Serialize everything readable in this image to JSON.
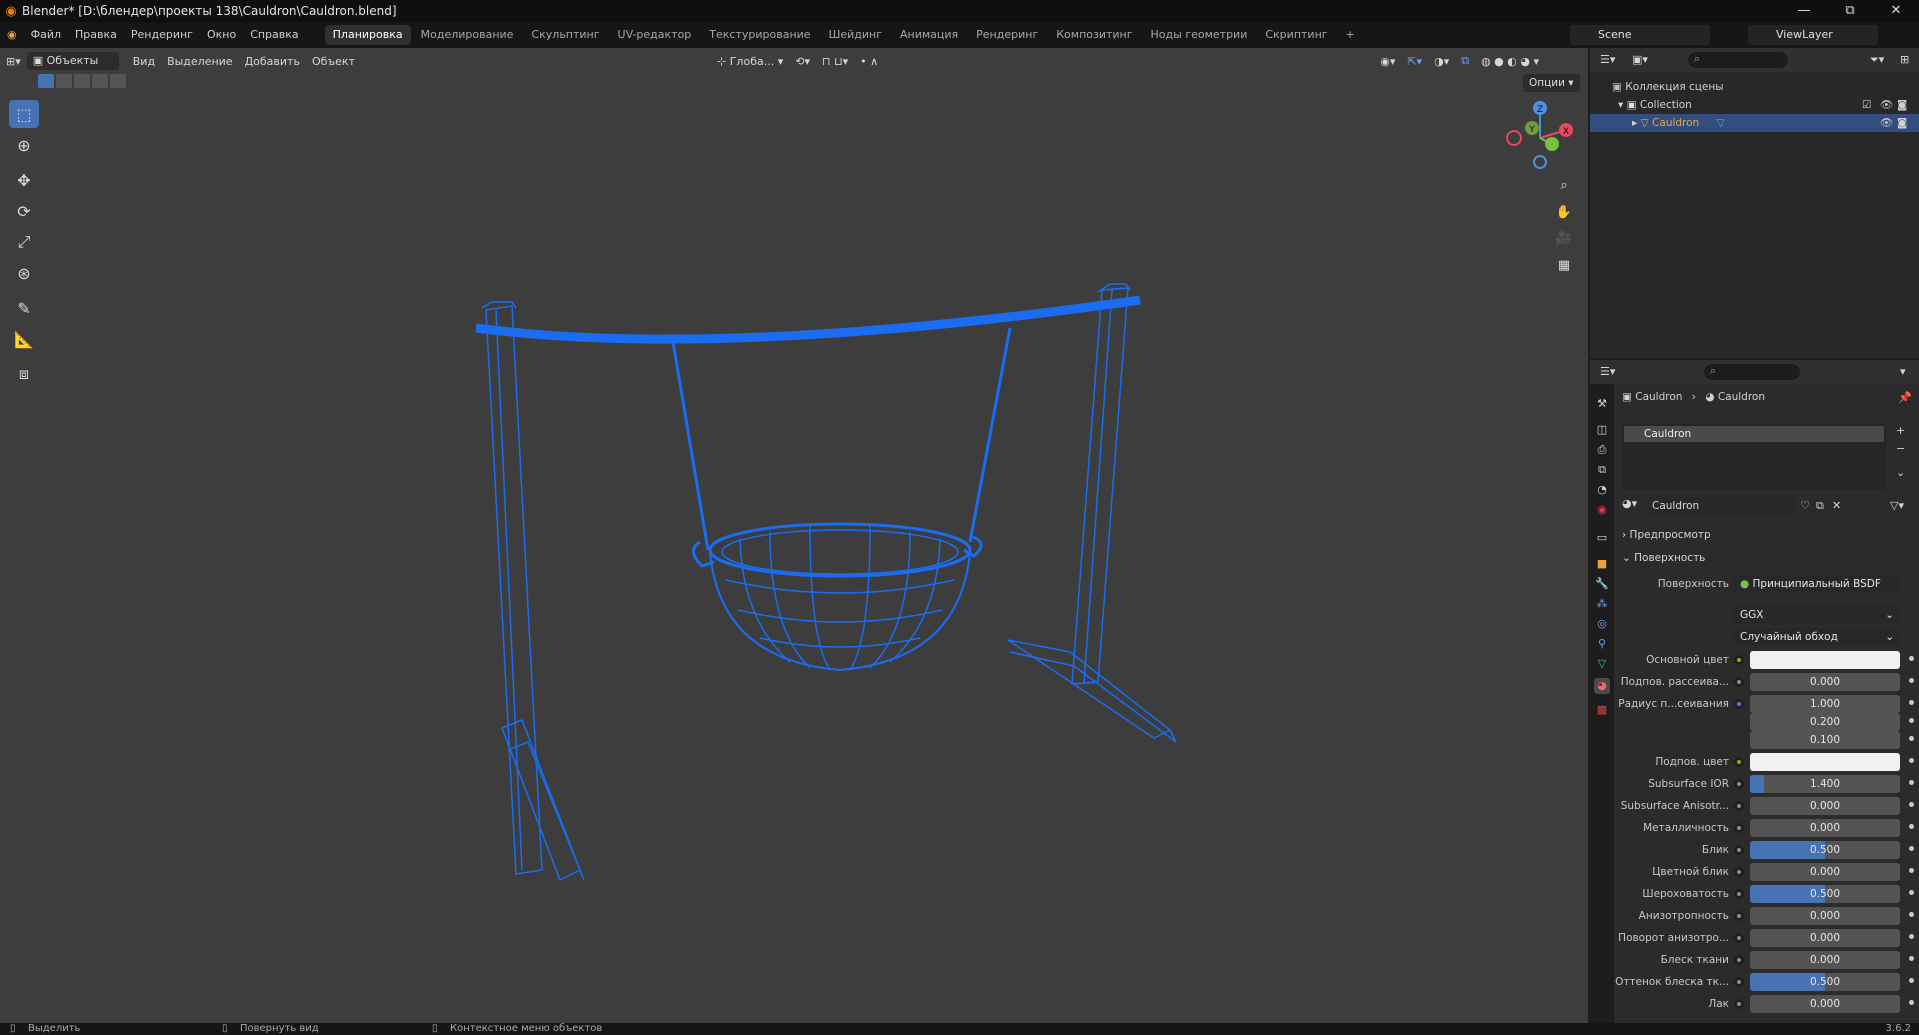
{
  "window": {
    "title": "Blender* [D:\\блендер\\проекты 138\\Cauldron\\Cauldron.blend]",
    "minimize": "—",
    "maximize": "⧉",
    "close": "✕"
  },
  "menu": [
    "Файл",
    "Правка",
    "Рендеринг",
    "Окно",
    "Справка"
  ],
  "workspaces": [
    "Планировка",
    "Моделирование",
    "Скульптинг",
    "UV-редактор",
    "Текстурирование",
    "Шейдинг",
    "Анимация",
    "Рендеринг",
    "Композитинг",
    "Ноды геометрии",
    "Скриптинг",
    "+"
  ],
  "scene": "Scene",
  "view_layer": "ViewLayer",
  "viewport_header": {
    "mode": "Объекты",
    "menus": [
      "Вид",
      "Выделение",
      "Добавить",
      "Объект"
    ],
    "transform": "Глоба...",
    "options": "Опции"
  },
  "gizmo": {
    "z": "Z",
    "y": "Y",
    "x": "X"
  },
  "outliner": {
    "scene_collection": "Коллекция сцены",
    "collection": "Collection",
    "object": "Cauldron"
  },
  "properties": {
    "breadcrumb_object": "Cauldron",
    "breadcrumb_material": "Cauldron",
    "slot": "Cauldron",
    "material_name": "Cauldron",
    "panel_preview": "Предпросмотр",
    "panel_surface": "Поверхность",
    "surface_label": "Поверхность",
    "surface_shader": "Принципиальный BSDF",
    "distribution": "GGX",
    "subsurface_method": "Случайный обход",
    "rows": [
      {
        "label": "Основной цвет",
        "value": "",
        "type": "color",
        "fill": 0
      },
      {
        "label": "Подпов. рассеива...",
        "value": "0.000",
        "type": "num",
        "fill": 0
      },
      {
        "label": "Радиус п...сеивания",
        "value": "1.000",
        "type": "num",
        "fill": 0
      },
      {
        "label": "",
        "value": "0.200",
        "type": "num",
        "fill": 0
      },
      {
        "label": "",
        "value": "0.100",
        "type": "num",
        "fill": 0
      },
      {
        "label": "Подпов. цвет",
        "value": "",
        "type": "color",
        "fill": 0
      },
      {
        "label": "Subsurface IOR",
        "value": "1.400",
        "type": "num",
        "fill": 0.09
      },
      {
        "label": "Subsurface Anisotr...",
        "value": "0.000",
        "type": "num",
        "fill": 0
      },
      {
        "label": "Металличность",
        "value": "0.000",
        "type": "num",
        "fill": 0
      },
      {
        "label": "Блик",
        "value": "0.500",
        "type": "num",
        "fill": 0.5
      },
      {
        "label": "Цветной блик",
        "value": "0.000",
        "type": "num",
        "fill": 0
      },
      {
        "label": "Шероховатость",
        "value": "0.500",
        "type": "num",
        "fill": 0.5
      },
      {
        "label": "Анизотропность",
        "value": "0.000",
        "type": "num",
        "fill": 0
      },
      {
        "label": "Поворот анизотро...",
        "value": "0.000",
        "type": "num",
        "fill": 0
      },
      {
        "label": "Блеск ткани",
        "value": "0.000",
        "type": "num",
        "fill": 0
      },
      {
        "label": "Оттенок блеска тк...",
        "value": "0.500",
        "type": "num",
        "fill": 0.5
      },
      {
        "label": "Лак",
        "value": "0.000",
        "type": "num",
        "fill": 0
      }
    ]
  },
  "statusbar": {
    "select": "Выделить",
    "rotate": "Повернуть вид",
    "context": "Контекстное меню объектов",
    "version": "3.6.2"
  },
  "colors": {
    "accent": "#4772b3",
    "wire": "#1a6df0",
    "selected_row": "#334d80",
    "orange": "#e8a33d"
  }
}
